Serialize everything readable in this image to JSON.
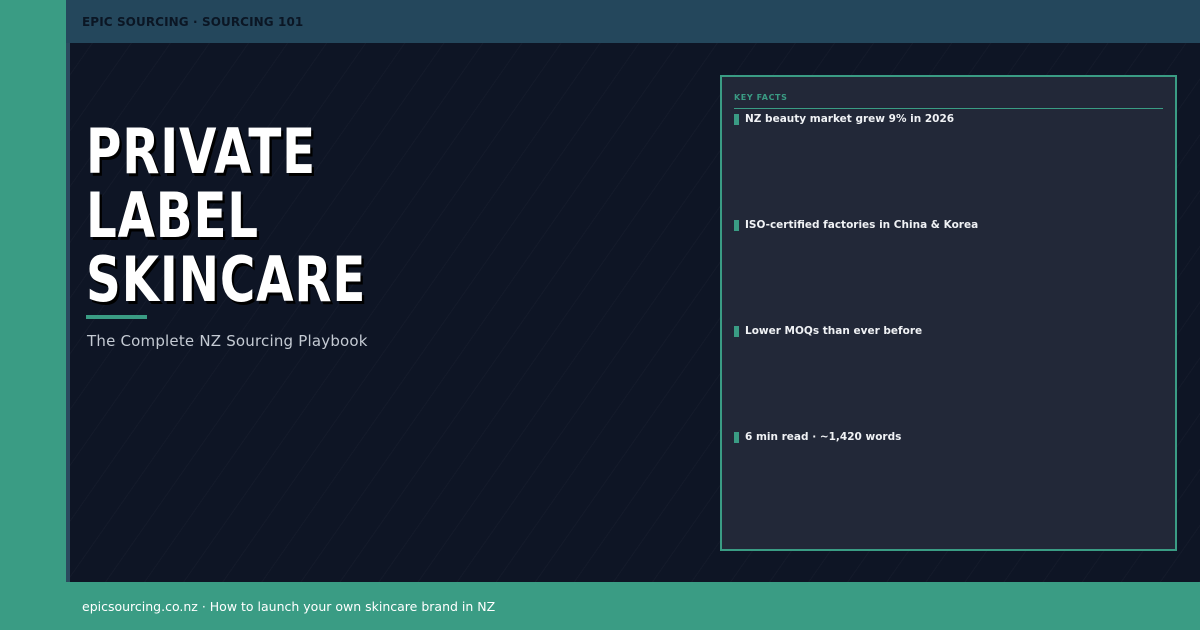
{
  "header": {
    "breadcrumb": "EPIC SOURCING · SOURCING 101"
  },
  "hero": {
    "title_lines": [
      "PRIVATE",
      "LABEL",
      "SKINCARE"
    ],
    "subtitle": "The Complete NZ Sourcing Playbook"
  },
  "key_facts": {
    "heading": "KEY FACTS",
    "items": [
      "NZ beauty market grew 9% in 2026",
      "ISO-certified factories in China & Korea",
      "Lower MOQs than ever before",
      "6 min read · ~1,420 words"
    ]
  },
  "footer": {
    "text": "epicsourcing.co.nz · How to launch your own skincare brand in NZ"
  },
  "colors": {
    "accent": "#3a9c84",
    "background": "#0e1525",
    "topbar": "#24475c",
    "panel": "#222838"
  }
}
